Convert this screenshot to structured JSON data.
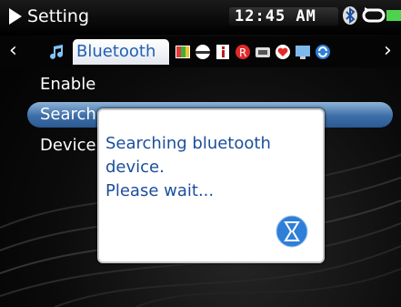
{
  "header": {
    "title": "Setting",
    "time": "12:45 AM"
  },
  "tabs": {
    "active_label": "Bluetooth"
  },
  "menu": {
    "items": [
      "Enable",
      "Search",
      "Device"
    ]
  },
  "dialog": {
    "line1": "Searching bluetooth",
    "line2": "device.",
    "line3": "Please wait..."
  },
  "colors": {
    "accent": "#1c4e9c",
    "selection": "#3d6ea8",
    "battery": "#4fd34f"
  },
  "icons": [
    "play-icon",
    "bluetooth-icon",
    "repeat-icon",
    "battery-icon",
    "music-note-icon",
    "color-palette-icon",
    "disc-icon",
    "info-icon",
    "record-icon",
    "video-icon",
    "heart-icon",
    "display-icon",
    "sync-icon",
    "hourglass-icon"
  ]
}
